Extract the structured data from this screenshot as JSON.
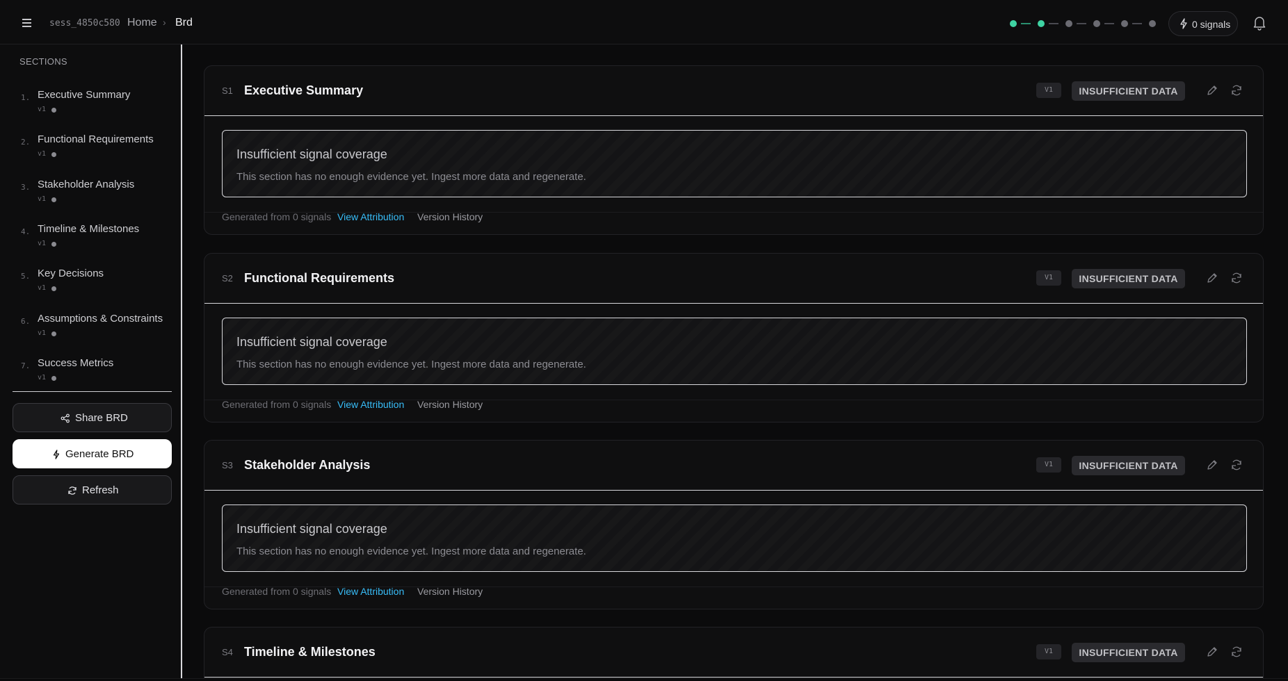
{
  "header": {
    "session_id": "sess_4850c580",
    "breadcrumb_home": "Home",
    "breadcrumb_sep": "›",
    "breadcrumb_current": "Brd",
    "signals_label": "0 signals"
  },
  "progress": {
    "steps_total": 6,
    "steps_done": 2
  },
  "sidebar": {
    "title": "SECTIONS",
    "items": [
      {
        "num": "1.",
        "label": "Executive Summary",
        "version": "v1"
      },
      {
        "num": "2.",
        "label": "Functional Requirements",
        "version": "v1"
      },
      {
        "num": "3.",
        "label": "Stakeholder Analysis",
        "version": "v1"
      },
      {
        "num": "4.",
        "label": "Timeline & Milestones",
        "version": "v1"
      },
      {
        "num": "5.",
        "label": "Key Decisions",
        "version": "v1"
      },
      {
        "num": "6.",
        "label": "Assumptions & Constraints",
        "version": "v1"
      },
      {
        "num": "7.",
        "label": "Success Metrics",
        "version": "v1"
      }
    ],
    "share_label": "Share BRD",
    "generate_label": "Generate BRD",
    "refresh_label": "Refresh"
  },
  "sections": [
    {
      "num": "S1",
      "title": "Executive Summary",
      "version": "V1",
      "status": "INSUFFICIENT DATA",
      "notice_title": "Insufficient signal coverage",
      "notice_body": "This section has no enough evidence yet. Ingest more data and regenerate.",
      "generated": "Generated from 0 signals",
      "attribution": "View Attribution",
      "history": "Version History"
    },
    {
      "num": "S2",
      "title": "Functional Requirements",
      "version": "V1",
      "status": "INSUFFICIENT DATA",
      "notice_title": "Insufficient signal coverage",
      "notice_body": "This section has no enough evidence yet. Ingest more data and regenerate.",
      "generated": "Generated from 0 signals",
      "attribution": "View Attribution",
      "history": "Version History"
    },
    {
      "num": "S3",
      "title": "Stakeholder Analysis",
      "version": "V1",
      "status": "INSUFFICIENT DATA",
      "notice_title": "Insufficient signal coverage",
      "notice_body": "This section has no enough evidence yet. Ingest more data and regenerate.",
      "generated": "Generated from 0 signals",
      "attribution": "View Attribution",
      "history": "Version History"
    },
    {
      "num": "S4",
      "title": "Timeline & Milestones",
      "version": "V1",
      "status": "INSUFFICIENT DATA"
    }
  ],
  "colors": {
    "accent_done": "#3fd3a3",
    "link": "#38bdf8",
    "background": "#0b0b0c"
  }
}
